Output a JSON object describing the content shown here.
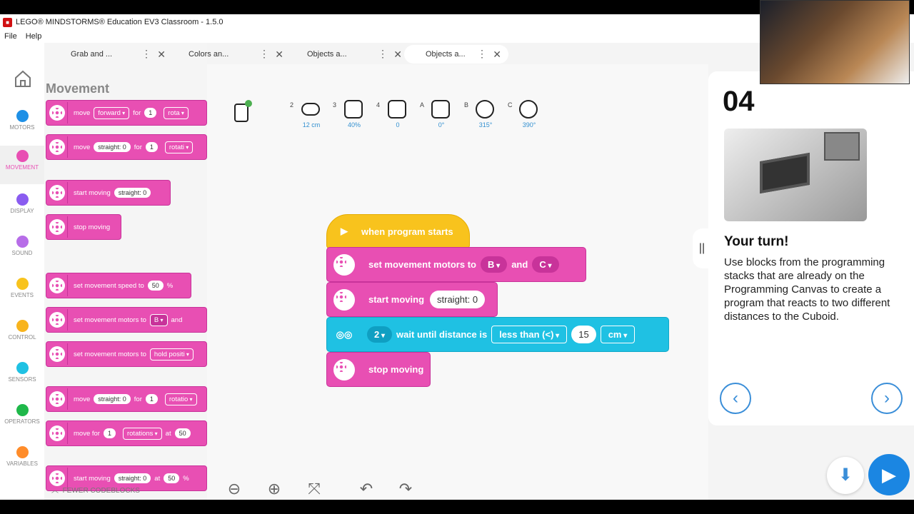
{
  "window": {
    "title": "LEGO® MINDSTORMS® Education EV3 Classroom - 1.5.0"
  },
  "menu": [
    "File",
    "Help"
  ],
  "tabs": [
    {
      "label": "Grab and ..."
    },
    {
      "label": "Colors an..."
    },
    {
      "label": "Objects a..."
    },
    {
      "label": "Objects a..."
    }
  ],
  "categories": [
    {
      "label": "MOTORS",
      "color": "#1e90e6"
    },
    {
      "label": "MOVEMENT",
      "color": "#e84fb3"
    },
    {
      "label": "DISPLAY",
      "color": "#8a5cf0"
    },
    {
      "label": "SOUND",
      "color": "#b76de8"
    },
    {
      "label": "EVENTS",
      "color": "#f8c31d"
    },
    {
      "label": "CONTROL",
      "color": "#f8b41d"
    },
    {
      "label": "SENSORS",
      "color": "#1fc1e3"
    },
    {
      "label": "OPERATORS",
      "color": "#1fb84a"
    },
    {
      "label": "VARIABLES",
      "color": "#ff8c2a"
    }
  ],
  "palette": {
    "title": "Movement",
    "footer": "FEWER CODEBLOCKS",
    "blocks": [
      {
        "t1": "move",
        "d1": "forward",
        "t2": "for",
        "p1": "1",
        "d2": "rota"
      },
      {
        "t1": "move",
        "p0": "straight: 0",
        "t2": "for",
        "p1": "1",
        "d2": "rotati"
      },
      {
        "t1": "start moving",
        "p0": "straight: 0"
      },
      {
        "t1": "stop moving"
      },
      {
        "t1": "set movement speed to",
        "p1": "50",
        "t2": "%"
      },
      {
        "t1": "set movement motors to",
        "d1": "B",
        "t2": "and"
      },
      {
        "t1": "set movement motors to",
        "d1": "hold positi"
      },
      {
        "t1": "move",
        "p0": "straight: 0",
        "t2": "for",
        "p1": "1",
        "d2": "rotatio"
      },
      {
        "t1": "move for",
        "p1": "1",
        "d2": "rotations",
        "t2": "at",
        "p2": "50"
      },
      {
        "t1": "start moving",
        "p0": "straight: 0",
        "t2": "at",
        "p1": "50",
        "t3": "%"
      }
    ]
  },
  "ports": [
    {
      "port": "2",
      "value": "12 cm"
    },
    {
      "port": "3",
      "value": "40%"
    },
    {
      "port": "4",
      "value": "0"
    },
    {
      "port": "A",
      "value": "0°"
    },
    {
      "port": "B",
      "value": "315°"
    },
    {
      "port": "C",
      "value": "390°"
    }
  ],
  "program": {
    "start": "when program starts",
    "set_motors": {
      "label": "set movement motors to",
      "m1": "B",
      "and": "and",
      "m2": "C"
    },
    "start_moving": {
      "label": "start moving",
      "value": "straight: 0"
    },
    "wait": {
      "port": "2",
      "label": "wait until distance is",
      "cmp": "less than (<)",
      "value": "15",
      "unit": "cm"
    },
    "stop": "stop moving"
  },
  "lesson": {
    "number": "04",
    "heading": "Your turn!",
    "body": "Use blocks from the programming stacks that are already on the Programming Canvas to create a program that reacts to two different distances to the Cuboid."
  }
}
